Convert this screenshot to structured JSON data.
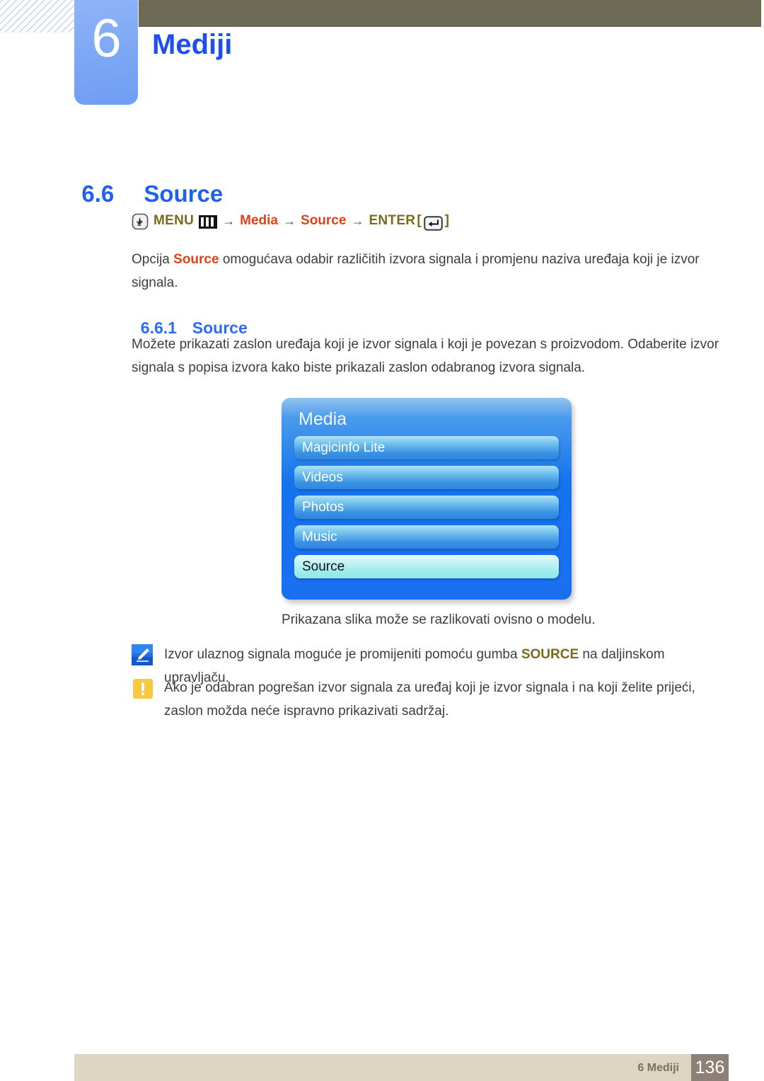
{
  "header": {
    "chapter_number": "6",
    "chapter_title": "Mediji",
    "accent_blue": "#1b4ff0",
    "bar_color": "#6d6a55",
    "block_color": "#7fa9f6"
  },
  "section": {
    "number": "6.6",
    "title": "Source"
  },
  "menu_path": {
    "hand_icon": "hand-click-icon",
    "menu_label": "MENU",
    "bars_icon": "menu-bars-icon",
    "arrow": "→",
    "item_1": "Media",
    "item_2": "Source",
    "enter_label": "ENTER",
    "bracket_open": "[",
    "bracket_close": "]",
    "enter_icon": "enter-key-icon",
    "olive_color": "#7a6a1e",
    "red_color": "#e2401a"
  },
  "intro_paragraph": {
    "before": "Opcija ",
    "highlight": "Source",
    "after": " omogućava odabir različitih izvora signala i promjenu naziva uređaja koji je izvor signala."
  },
  "subsection": {
    "number": "6.6.1",
    "title": "Source"
  },
  "description_paragraph": "Možete prikazati zaslon uređaja koji je izvor signala i koji je povezan s proizvodom. Odaberite izvor signala s popisa izvora kako biste prikazali zaslon odabranog izvora signala.",
  "osd": {
    "title": "Media",
    "items": [
      {
        "label": "Magicinfo Lite",
        "selected": false
      },
      {
        "label": "Videos",
        "selected": false
      },
      {
        "label": "Photos",
        "selected": false
      },
      {
        "label": "Music",
        "selected": false
      },
      {
        "label": "Source",
        "selected": true
      }
    ],
    "caption": "Prikazana slika može se razlikovati ovisno o modelu."
  },
  "notes": [
    {
      "icon": "note-pencil-icon",
      "before": "Izvor ulaznog signala moguće je promijeniti pomoću gumba ",
      "highlight": "SOURCE",
      "after": " na daljinskom upravljaču."
    },
    {
      "icon": "warning-exclamation-icon",
      "before": "Ako je odabran pogrešan izvor signala za uređaj koji je izvor signala i na koji želite prijeći, zaslon možda neće ispravno prikazivati sadržaj.",
      "highlight": "",
      "after": ""
    }
  ],
  "footer": {
    "label": "6 Mediji",
    "page_number": "136",
    "bar_color": "#dcd6c3",
    "page_box_color": "#8d8077"
  }
}
